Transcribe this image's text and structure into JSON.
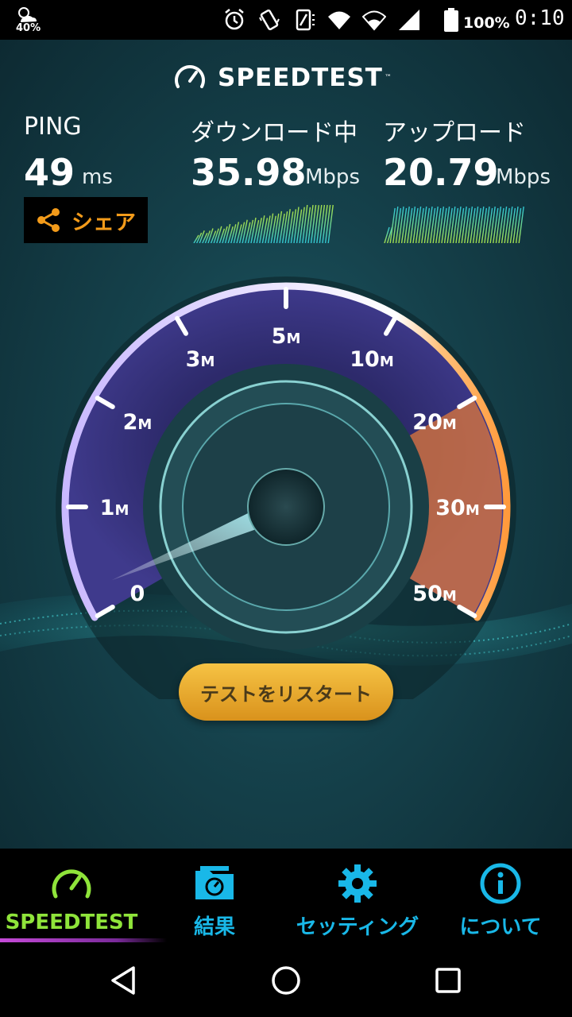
{
  "status_bar": {
    "weather_temp": "40%",
    "battery_percent": "100%",
    "time": "0:10",
    "icons": [
      "weather-icon",
      "alarm-icon",
      "vibrate-icon",
      "no-sim-icon",
      "wifi-icon",
      "wifi-icon",
      "signal-icon",
      "battery-icon"
    ]
  },
  "app": {
    "logo_text": "SPEEDTEST",
    "logo_tm": "™",
    "ping": {
      "label": "PING",
      "value": "49",
      "unit": "ms"
    },
    "download": {
      "label": "ダウンロード中",
      "value": "35.98",
      "unit": "Mbps"
    },
    "upload": {
      "label": "アップロード",
      "value": "20.79",
      "unit": "Mbps"
    },
    "share_label": "シェア",
    "gauge": {
      "ticks": [
        "0",
        "1M",
        "2M",
        "3M",
        "5M",
        "10M",
        "20M",
        "30M",
        "50M"
      ],
      "current_speed_mbps": 35.98
    },
    "restart_button": "テストをリスタート"
  },
  "tabs": [
    {
      "label": "SPEEDTEST",
      "icon": "speedometer-icon",
      "active": true
    },
    {
      "label": "結果",
      "icon": "results-folder-icon",
      "active": false
    },
    {
      "label": "セッティング",
      "icon": "gear-icon",
      "active": false
    },
    {
      "label": "について",
      "icon": "info-icon",
      "active": false
    }
  ],
  "nav": [
    "back-icon",
    "home-icon",
    "recents-icon"
  ],
  "colors": {
    "accent_orange": "#f39b1a",
    "accent_green": "#8fe43a",
    "accent_blue": "#19b8e8",
    "gauge_purple": "#8e6bd8",
    "gauge_orange": "#e8813a"
  }
}
